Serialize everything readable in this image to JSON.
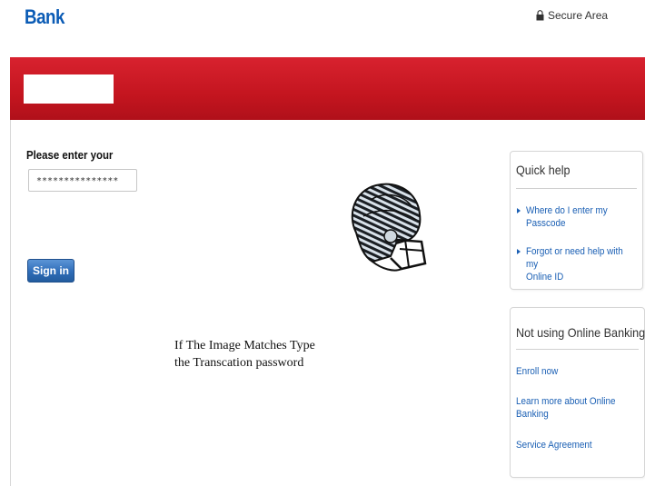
{
  "header": {
    "logo_text": "Bank",
    "secure_label": "Secure Area"
  },
  "form": {
    "prompt_label": "Please enter your",
    "password_value": "***************",
    "signin_label": "Sign in"
  },
  "image_caption": {
    "line1": "If The Image Matches Type",
    "line2": "the Transcation password"
  },
  "quick_help": {
    "title": "Quick help",
    "links": [
      {
        "line1": "Where do I enter my",
        "line2": "Passcode"
      },
      {
        "line1": "Forgot or need help with my",
        "line2": "Online ID"
      }
    ]
  },
  "not_using": {
    "title": "Not using Online Banking?",
    "links": [
      {
        "line1": "Enroll now",
        "line2": ""
      },
      {
        "line1": "Learn more about Online",
        "line2": "Banking"
      },
      {
        "line1": "Service Agreement",
        "line2": ""
      }
    ]
  },
  "colors": {
    "brand_blue": "#0a5bb5",
    "band_red": "#c4151f",
    "link_blue": "#1a5fb4"
  },
  "icons": {
    "secure": "lock-icon",
    "image": "football-helmet-icon",
    "bullet": "triangle-right-icon"
  }
}
